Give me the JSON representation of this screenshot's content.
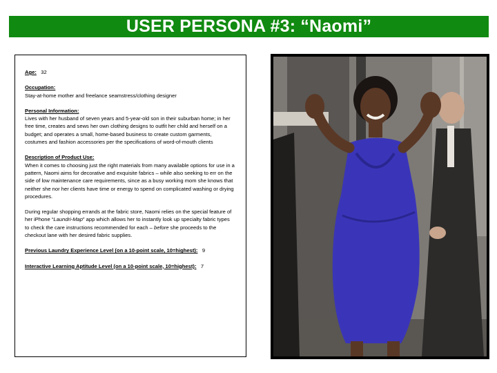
{
  "header": {
    "title": "USER PERSONA #3: “Naomi”"
  },
  "colors": {
    "title_bar": "#108a10",
    "title_text": "#ffffff",
    "dress": "#3a35b8"
  },
  "persona": {
    "age": {
      "label": "Age:",
      "value": "32"
    },
    "occupation": {
      "label": "Occupation:",
      "text": "Stay-at-home mother and freelance seamstress/clothing designer"
    },
    "personal_information": {
      "label": "Personal Information:",
      "text": "Lives with her husband of seven years and 5-year-old son in their suburban home; in her free time, creates and sews her own clothing designs to outfit her child and herself on a budget; and operates a small, home-based business to create custom garments, costumes and fashion accessories per the specifications of word-of-mouth clients"
    },
    "product_use": {
      "label": "Description of Product Use:",
      "paragraph1": "When it comes to choosing just the right materials from many available options for use in a pattern, Naomi aims for decorative and exquisite fabrics – while also seeking to err on the side of low maintenance care requirements, since as a busy working mom she knows that neither she nor her clients have time or energy to spend on complicated washing or drying procedures.",
      "paragraph2_before_app": "During regular shopping errands at the fabric store, Naomi relies on the special feature of her iPhone “",
      "app_name": "Laundri-Map",
      "paragraph2_after_app": "” app which allows her to instantly look up specialty fabric types to check the care instructions    recommended for each – ",
      "before_word": "before",
      "paragraph2_end": " she proceeds to the checkout lane with her desired fabric supplies."
    },
    "laundry_experience": {
      "label": "Previous Laundry Experience Level (on a 10-point scale, 10=highest):",
      "value": "9"
    },
    "learning_aptitude": {
      "label": "Interactive Learning Aptitude Level (on a 10-point scale, 10=highest):",
      "value": "7"
    }
  },
  "photo": {
    "subject": "woman-in-purple-dress-waving"
  }
}
